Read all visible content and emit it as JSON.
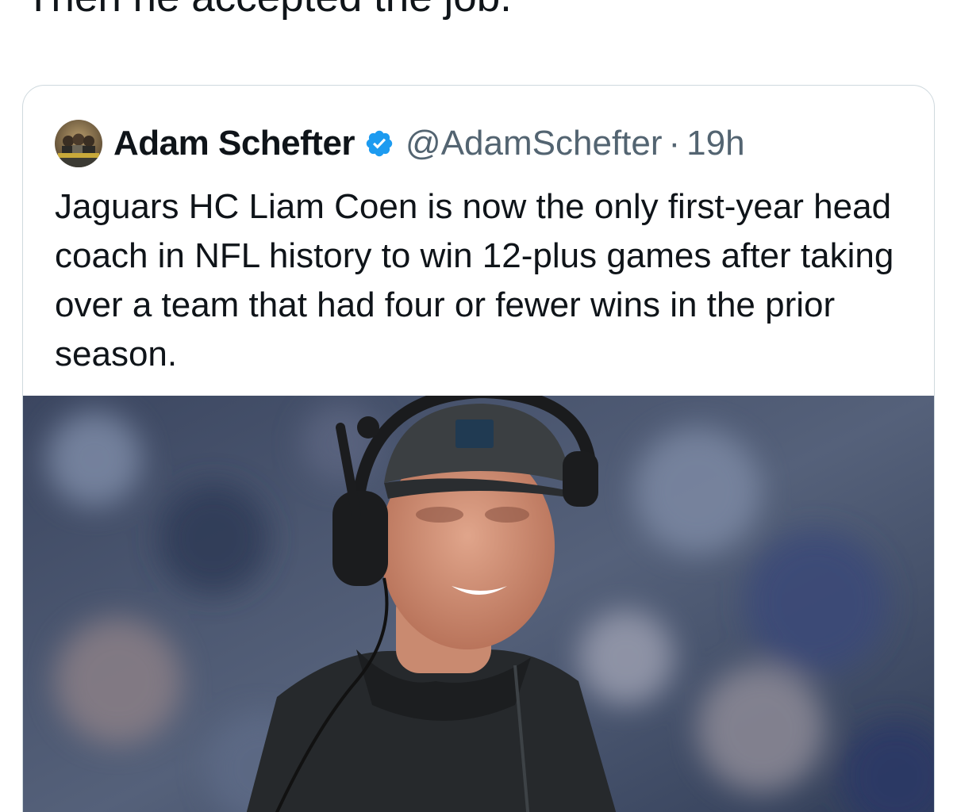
{
  "post": {
    "text": "Then he accepted the job."
  },
  "quoted_post": {
    "author": {
      "display_name": "Adam Schefter",
      "handle": "@AdamSchefter",
      "verified": true,
      "avatar_icon": "avatar-image",
      "verified_icon": "verified-badge-icon"
    },
    "separator": "·",
    "timestamp": "19h",
    "text": "Jaguars HC Liam Coen is now the only first-year head coach in NFL history to win 12-plus games after taking over a team that had four or fewer wins in the prior season.",
    "media": {
      "kind": "photo"
    }
  },
  "colors": {
    "text_primary": "#0f1419",
    "text_secondary": "#536471",
    "card_border": "#cfd9de",
    "verified_blue": "#1d9bf0"
  }
}
